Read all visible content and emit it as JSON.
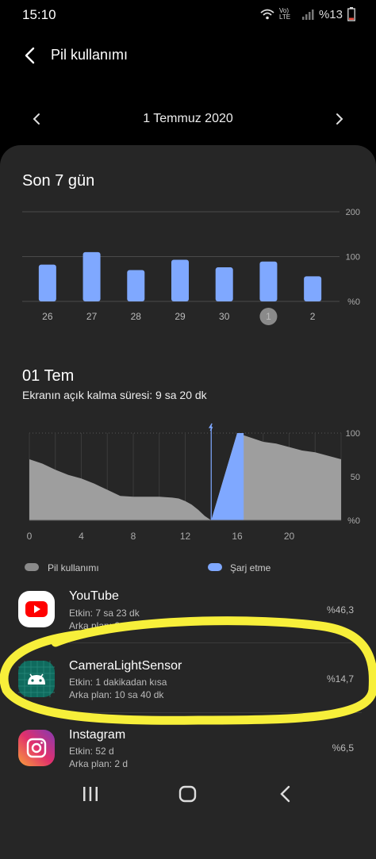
{
  "status_bar": {
    "time": "15:10",
    "network_label": "Vo) LTE",
    "battery_text": "%13"
  },
  "header": {
    "title": "Pil kullanımı",
    "back_icon": "chevron-left-icon"
  },
  "date_nav": {
    "label": "1 Temmuz 2020",
    "prev_icon": "chevron-left-icon",
    "next_icon": "chevron-right-icon"
  },
  "weekly": {
    "title": "Son 7 gün",
    "chart_data": {
      "type": "bar",
      "categories": [
        "26",
        "27",
        "28",
        "29",
        "30",
        "1",
        "2"
      ],
      "values": [
        82,
        110,
        70,
        93,
        76,
        89,
        56
      ],
      "selected_category": "1",
      "ylim": [
        0,
        200
      ],
      "yticks": [
        "200",
        "100",
        "%0"
      ],
      "color": "#7fa8ff",
      "grid": true
    }
  },
  "daily": {
    "title": "01 Tem",
    "screen_on_text": "Ekranın açık kalma süresi: 9 sa 20 dk",
    "chart_data": {
      "type": "area",
      "x": [
        0,
        1,
        2,
        3,
        4,
        5,
        6,
        7,
        8,
        9,
        10,
        11,
        11.5,
        12,
        12.5,
        13,
        13.5,
        14,
        15,
        16,
        17,
        18,
        19,
        20,
        21,
        22,
        23,
        24
      ],
      "y": [
        70,
        65,
        58,
        52,
        48,
        42,
        35,
        28,
        27,
        27,
        27,
        26,
        25,
        22,
        18,
        12,
        5,
        0,
        50,
        100,
        95,
        90,
        88,
        84,
        80,
        78,
        74,
        70
      ],
      "charging_range": [
        14,
        16.5
      ],
      "xlim": [
        0,
        24
      ],
      "ylim": [
        0,
        100
      ],
      "xticks": [
        "0",
        "4",
        "8",
        "12",
        "16",
        "20"
      ],
      "yticks": [
        "100",
        "50",
        "%0"
      ],
      "colors": {
        "usage": "#9e9e9e",
        "charging": "#7fa8ff"
      }
    },
    "legend": {
      "usage_label": "Pil kullanımı",
      "charging_label": "Şarj etme"
    }
  },
  "apps": [
    {
      "name": "YouTube",
      "line1": "Etkin: 7 sa 23 dk",
      "line2": "Arka plan: 2 sa",
      "percent": "%46,3",
      "icon": "youtube-icon"
    },
    {
      "name": "CameraLightSensor",
      "line1": "Etkin: 1 dakikadan kısa",
      "line2": "Arka plan: 10 sa 40 dk",
      "percent": "%14,7",
      "icon": "android-icon"
    },
    {
      "name": "Instagram",
      "line1": "Etkin: 52 d",
      "line2": "Arka plan: 2 d",
      "percent": "%6,5",
      "icon": "instagram-icon"
    }
  ],
  "annotation": {
    "color": "#f7ef3a"
  },
  "nav_bar": {
    "recent_icon": "recent-apps-icon",
    "home_icon": "home-icon",
    "back_icon": "back-icon"
  }
}
